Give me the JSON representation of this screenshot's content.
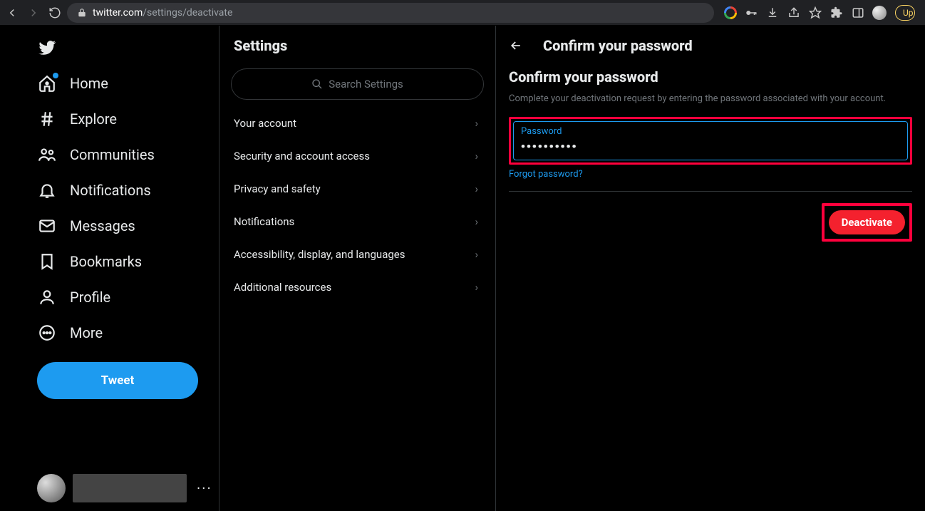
{
  "browser": {
    "url_host": "twitter.com",
    "url_path": "/settings/deactivate",
    "upgrade_label": "Up"
  },
  "nav": {
    "items": [
      {
        "label": "Home"
      },
      {
        "label": "Explore"
      },
      {
        "label": "Communities"
      },
      {
        "label": "Notifications"
      },
      {
        "label": "Messages"
      },
      {
        "label": "Bookmarks"
      },
      {
        "label": "Profile"
      },
      {
        "label": "More"
      }
    ],
    "tweet_label": "Tweet"
  },
  "settings": {
    "title": "Settings",
    "search_placeholder": "Search Settings",
    "items": [
      {
        "label": "Your account"
      },
      {
        "label": "Security and account access"
      },
      {
        "label": "Privacy and safety"
      },
      {
        "label": "Notifications"
      },
      {
        "label": "Accessibility, display, and languages"
      },
      {
        "label": "Additional resources"
      }
    ]
  },
  "detail": {
    "header_title": "Confirm your password",
    "subtitle": "Confirm your password",
    "description": "Complete your deactivation request by entering the password associated with your account.",
    "password_label": "Password",
    "password_value": "••••••••••",
    "forgot_label": "Forgot password?",
    "deactivate_label": "Deactivate"
  },
  "colors": {
    "accent": "#1d9bf0",
    "danger": "#f4212e",
    "highlight": "#ff003c"
  }
}
